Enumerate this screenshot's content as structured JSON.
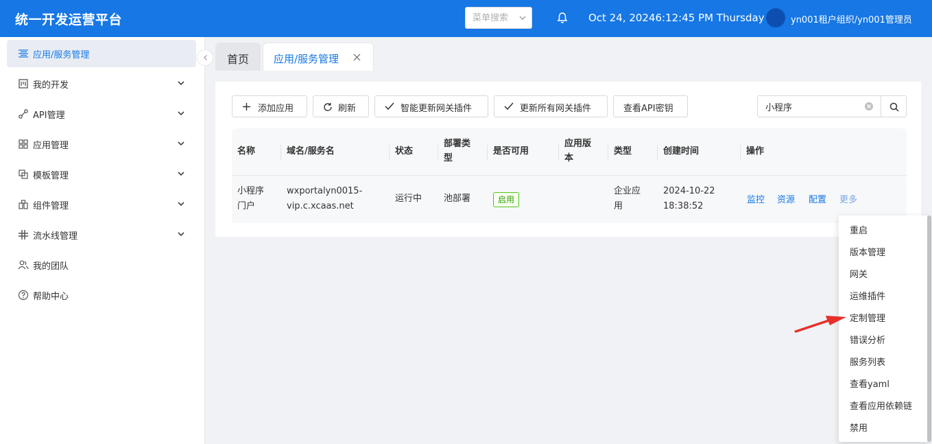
{
  "header": {
    "brand": "统一开发运营平台",
    "menu_search_placeholder": "菜单搜索",
    "datetime": "Oct 24, 20246:12:45 PM Thursday",
    "user": "yn001租户组织/yn001管理员"
  },
  "sidebar": {
    "items": [
      {
        "label": "应用/服务管理",
        "icon": "list-icon",
        "active": true,
        "expandable": false
      },
      {
        "label": "我的开发",
        "icon": "dev-icon",
        "active": false,
        "expandable": true
      },
      {
        "label": "API管理",
        "icon": "api-icon",
        "active": false,
        "expandable": true
      },
      {
        "label": "应用管理",
        "icon": "grid-icon",
        "active": false,
        "expandable": true
      },
      {
        "label": "模板管理",
        "icon": "template-icon",
        "active": false,
        "expandable": true
      },
      {
        "label": "组件管理",
        "icon": "component-icon",
        "active": false,
        "expandable": true
      },
      {
        "label": "流水线管理",
        "icon": "pipeline-icon",
        "active": false,
        "expandable": true
      },
      {
        "label": "我的团队",
        "icon": "team-icon",
        "active": false,
        "expandable": false
      },
      {
        "label": "帮助中心",
        "icon": "help-icon",
        "active": false,
        "expandable": false
      }
    ]
  },
  "tabs": [
    {
      "label": "首页",
      "active": false
    },
    {
      "label": "应用/服务管理",
      "active": true
    }
  ],
  "toolbar": {
    "add_label": "添加应用",
    "refresh_label": "刷新",
    "smart_update_label": "智能更新网关插件",
    "update_all_label": "更新所有网关插件",
    "api_key_label": "查看API密钥",
    "search_value": "小程序"
  },
  "table": {
    "headers": [
      "名称",
      "域名/服务名",
      "状态",
      "部署类型",
      "是否可用",
      "应用版本",
      "类型",
      "创建时间",
      "操作"
    ],
    "rows": [
      {
        "name": "小程序门户",
        "domain_line1": "wxportalyn0015-",
        "domain_line2": "vip.c.xcaas.net",
        "status": "运行中",
        "deploy_type": "池部署",
        "enabled": "启用",
        "version": "",
        "type": "企业应用",
        "created_date": "2024-10-22",
        "created_time": "18:38:52",
        "ops": [
          "监控",
          "资源",
          "配置",
          "更多"
        ]
      }
    ]
  },
  "dropdown": {
    "items": [
      "重启",
      "版本管理",
      "网关",
      "运维插件",
      "定制管理",
      "错误分析",
      "服务列表",
      "查看yaml",
      "查看应用依赖链",
      "禁用"
    ]
  },
  "colors": {
    "primary": "#1677e5",
    "annotation_arrow": "#e8302a",
    "enabled_green": "#52c41a"
  }
}
